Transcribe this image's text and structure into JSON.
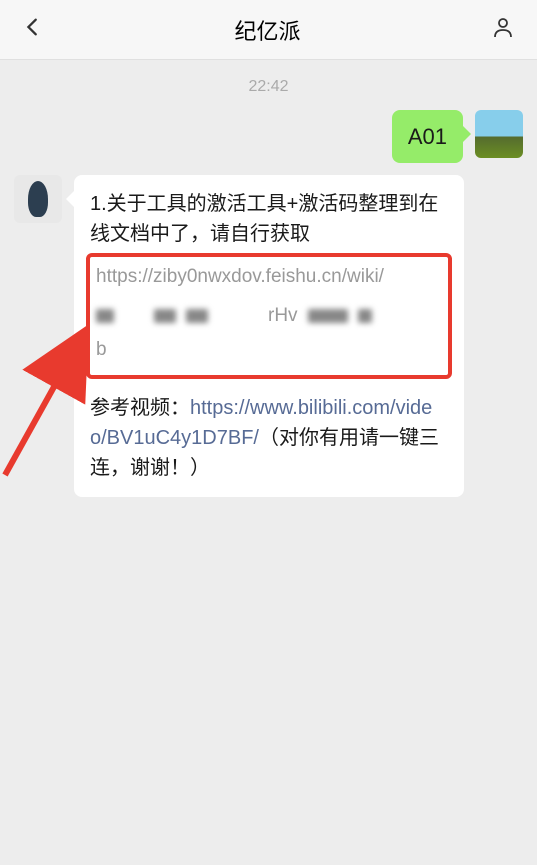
{
  "header": {
    "title": "纪亿派"
  },
  "timestamp": "22:42",
  "messages": {
    "outgoing": {
      "text": "A01"
    },
    "incoming": {
      "intro": "1.关于工具的激活工具+激活码整理到在线文档中了，请自行获取",
      "doc_url": "https://ziby0nwxdov.feishu.cn/wiki/",
      "partial_fragment": "rHv",
      "trailing_char": "b",
      "video_label": "参考视频：",
      "video_url": "https://www.bilibili.com/video/BV1uC4y1D7BF/",
      "video_suffix": "（对你有用请一键三连，谢谢！）"
    }
  }
}
